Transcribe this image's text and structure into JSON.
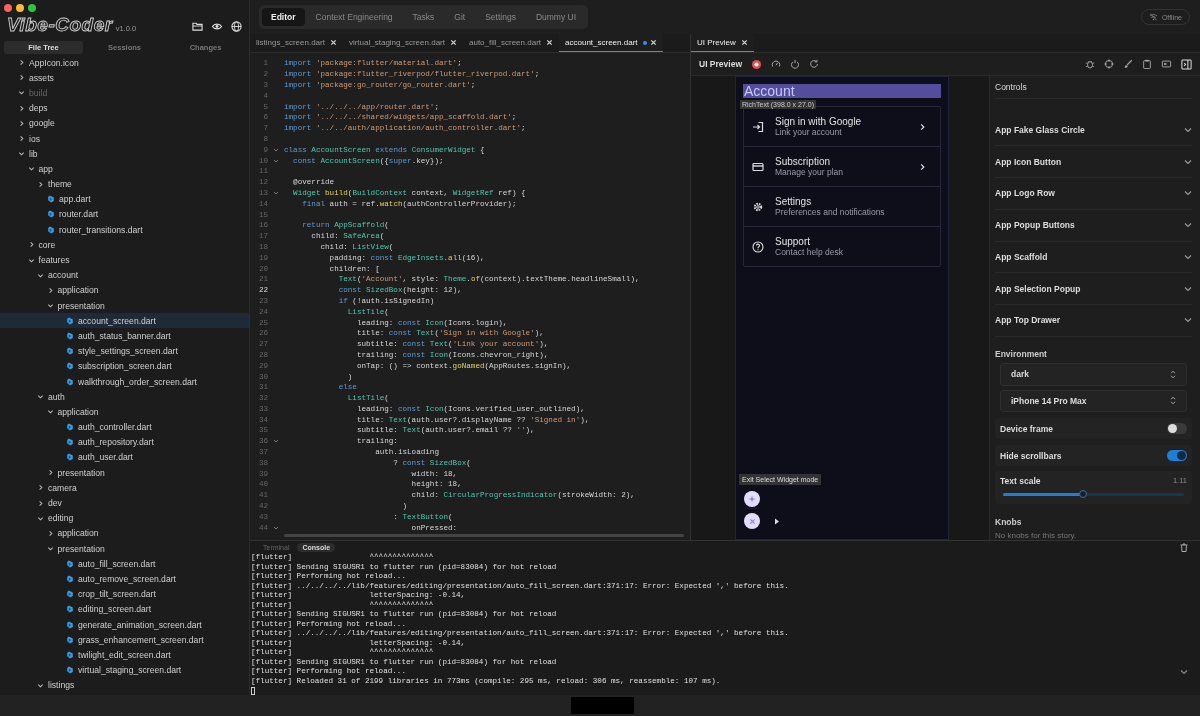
{
  "window": {
    "logo": "Vibe-Coder",
    "version": "v1.0.0"
  },
  "sidebar": {
    "tabs": [
      {
        "label": "File Tree",
        "selected": true
      },
      {
        "label": "Sessions",
        "selected": false
      },
      {
        "label": "Changes",
        "selected": false
      }
    ],
    "tree": [
      {
        "name": "AppIcon.icon",
        "kind": "folder",
        "expanded": false,
        "selected": false,
        "ignored": false
      },
      {
        "name": "assets",
        "kind": "folder",
        "expanded": false,
        "selected": false,
        "ignored": false
      },
      {
        "name": "build",
        "kind": "folder",
        "expanded": true,
        "selected": false,
        "ignored": true
      },
      {
        "name": "deps",
        "kind": "folder",
        "expanded": false,
        "selected": false,
        "ignored": false
      },
      {
        "name": "google",
        "kind": "folder",
        "expanded": false,
        "selected": false,
        "ignored": false
      },
      {
        "name": "ios",
        "kind": "folder",
        "expanded": false,
        "selected": false,
        "ignored": false
      },
      {
        "name": "lib",
        "kind": "folder",
        "expanded": true,
        "selected": false,
        "ignored": false,
        "children": [
          {
            "name": "app",
            "kind": "folder",
            "expanded": true,
            "selected": false,
            "ignored": false,
            "children": [
              {
                "name": "theme",
                "kind": "folder",
                "expanded": false,
                "selected": false,
                "ignored": false
              },
              {
                "name": "app.dart",
                "kind": "file",
                "selected": false,
                "ignored": false
              },
              {
                "name": "router.dart",
                "kind": "file",
                "selected": false,
                "ignored": false
              },
              {
                "name": "router_transitions.dart",
                "kind": "file",
                "selected": false,
                "ignored": false
              }
            ]
          },
          {
            "name": "core",
            "kind": "folder",
            "expanded": false,
            "selected": false,
            "ignored": false
          },
          {
            "name": "features",
            "kind": "folder",
            "expanded": true,
            "selected": false,
            "ignored": false,
            "children": [
              {
                "name": "account",
                "kind": "folder",
                "expanded": true,
                "selected": false,
                "ignored": false,
                "children": [
                  {
                    "name": "application",
                    "kind": "folder",
                    "expanded": false,
                    "selected": false,
                    "ignored": false
                  },
                  {
                    "name": "presentation",
                    "kind": "folder",
                    "expanded": true,
                    "selected": false,
                    "ignored": false,
                    "children": [
                      {
                        "name": "account_screen.dart",
                        "kind": "file",
                        "selected": true,
                        "ignored": false
                      },
                      {
                        "name": "auth_status_banner.dart",
                        "kind": "file",
                        "selected": false,
                        "ignored": false
                      },
                      {
                        "name": "style_settings_screen.dart",
                        "kind": "file",
                        "selected": false,
                        "ignored": false
                      },
                      {
                        "name": "subscription_screen.dart",
                        "kind": "file",
                        "selected": false,
                        "ignored": false
                      },
                      {
                        "name": "walkthrough_order_screen.dart",
                        "kind": "file",
                        "selected": false,
                        "ignored": false
                      }
                    ]
                  }
                ]
              },
              {
                "name": "auth",
                "kind": "folder",
                "expanded": true,
                "selected": false,
                "ignored": false,
                "children": [
                  {
                    "name": "application",
                    "kind": "folder",
                    "expanded": true,
                    "selected": false,
                    "ignored": false,
                    "children": [
                      {
                        "name": "auth_controller.dart",
                        "kind": "file",
                        "selected": false,
                        "ignored": false
                      },
                      {
                        "name": "auth_repository.dart",
                        "kind": "file",
                        "selected": false,
                        "ignored": false
                      },
                      {
                        "name": "auth_user.dart",
                        "kind": "file",
                        "selected": false,
                        "ignored": false
                      }
                    ]
                  },
                  {
                    "name": "presentation",
                    "kind": "folder",
                    "expanded": false,
                    "selected": false,
                    "ignored": false
                  }
                ]
              },
              {
                "name": "camera",
                "kind": "folder",
                "expanded": false,
                "selected": false,
                "ignored": false
              },
              {
                "name": "dev",
                "kind": "folder",
                "expanded": false,
                "selected": false,
                "ignored": false
              },
              {
                "name": "editing",
                "kind": "folder",
                "expanded": true,
                "selected": false,
                "ignored": false,
                "children": [
                  {
                    "name": "application",
                    "kind": "folder",
                    "expanded": false,
                    "selected": false,
                    "ignored": false
                  },
                  {
                    "name": "presentation",
                    "kind": "folder",
                    "expanded": true,
                    "selected": false,
                    "ignored": false,
                    "children": [
                      {
                        "name": "auto_fill_screen.dart",
                        "kind": "file",
                        "selected": false,
                        "ignored": false
                      },
                      {
                        "name": "auto_remove_screen.dart",
                        "kind": "file",
                        "selected": false,
                        "ignored": false
                      },
                      {
                        "name": "crop_tilt_screen.dart",
                        "kind": "file",
                        "selected": false,
                        "ignored": false
                      },
                      {
                        "name": "editing_screen.dart",
                        "kind": "file",
                        "selected": false,
                        "ignored": false
                      },
                      {
                        "name": "generate_animation_screen.dart",
                        "kind": "file",
                        "selected": false,
                        "ignored": false
                      },
                      {
                        "name": "grass_enhancement_screen.dart",
                        "kind": "file",
                        "selected": false,
                        "ignored": false
                      },
                      {
                        "name": "twilight_edit_screen.dart",
                        "kind": "file",
                        "selected": false,
                        "ignored": false
                      },
                      {
                        "name": "virtual_staging_screen.dart",
                        "kind": "file",
                        "selected": false,
                        "ignored": false
                      }
                    ]
                  }
                ]
              },
              {
                "name": "listings",
                "kind": "folder",
                "expanded": true,
                "selected": false,
                "ignored": false
              }
            ]
          }
        ]
      }
    ]
  },
  "nav_tabs": [
    {
      "label": "Editor",
      "selected": true
    },
    {
      "label": "Context Engineering",
      "selected": false
    },
    {
      "label": "Tasks",
      "selected": false
    },
    {
      "label": "Git",
      "selected": false
    },
    {
      "label": "Settings",
      "selected": false
    },
    {
      "label": "Dummy UI",
      "selected": false
    }
  ],
  "status": {
    "label": "Offline"
  },
  "editor": {
    "tabs": [
      {
        "label": "listings_screen.dart",
        "selected": false,
        "modified": false
      },
      {
        "label": "virtual_staging_screen.dart",
        "selected": false,
        "modified": false
      },
      {
        "label": "auto_fill_screen.dart",
        "selected": false,
        "modified": false
      },
      {
        "label": "account_screen.dart",
        "selected": true,
        "modified": true
      }
    ],
    "lines": [
      {
        "number": "1",
        "foldable": false,
        "current": false,
        "tokens": [
          {
            "kind": "kw",
            "text": "import "
          },
          {
            "kind": "str",
            "text": "'package:flutter/material.dart'"
          },
          {
            "kind": "p",
            "text": ";"
          }
        ]
      },
      {
        "number": "2",
        "foldable": false,
        "current": false,
        "tokens": [
          {
            "kind": "kw",
            "text": "import "
          },
          {
            "kind": "str",
            "text": "'package:flutter_riverpod/flutter_riverpod.dart'"
          },
          {
            "kind": "p",
            "text": ";"
          }
        ]
      },
      {
        "number": "3",
        "foldable": false,
        "current": false,
        "tokens": [
          {
            "kind": "kw",
            "text": "import "
          },
          {
            "kind": "str",
            "text": "'package:go_router/go_router.dart'"
          },
          {
            "kind": "p",
            "text": ";"
          }
        ]
      },
      {
        "number": "4",
        "foldable": false,
        "current": false
      },
      {
        "number": "5",
        "foldable": false,
        "current": false,
        "tokens": [
          {
            "kind": "kw",
            "text": "import "
          },
          {
            "kind": "str",
            "text": "'../../../app/router.dart'"
          },
          {
            "kind": "p",
            "text": ";"
          }
        ]
      },
      {
        "number": "6",
        "foldable": false,
        "current": false,
        "tokens": [
          {
            "kind": "kw",
            "text": "import "
          },
          {
            "kind": "str",
            "text": "'../../../shared/widgets/app_scaffold.dart'"
          },
          {
            "kind": "p",
            "text": ";"
          }
        ]
      },
      {
        "number": "7",
        "foldable": false,
        "current": false,
        "tokens": [
          {
            "kind": "kw",
            "text": "import "
          },
          {
            "kind": "str",
            "text": "'../../auth/application/auth_controller.dart'"
          },
          {
            "kind": "p",
            "text": ";"
          }
        ]
      },
      {
        "number": "8",
        "foldable": false,
        "current": false
      },
      {
        "number": "9",
        "foldable": true,
        "current": false,
        "tokens": [
          {
            "kind": "kw",
            "text": "class "
          },
          {
            "kind": "type",
            "text": "AccountScreen "
          },
          {
            "kind": "kw",
            "text": "extends "
          },
          {
            "kind": "type",
            "text": "ConsumerWidget"
          },
          {
            "kind": "p",
            "text": " {"
          }
        ]
      },
      {
        "number": "10",
        "foldable": true,
        "current": false,
        "tokens": [
          {
            "kind": "kw",
            "text": "  const "
          },
          {
            "kind": "type",
            "text": "AccountScreen"
          },
          {
            "kind": "p",
            "text": "({"
          },
          {
            "kind": "kw",
            "text": "super"
          },
          {
            "kind": "p",
            "text": ".key});"
          }
        ]
      },
      {
        "number": "11",
        "foldable": false,
        "current": false
      },
      {
        "number": "12",
        "foldable": false,
        "current": false,
        "tokens": [
          {
            "kind": "p",
            "text": "  @override"
          }
        ]
      },
      {
        "number": "13",
        "foldable": true,
        "current": false,
        "tokens": [
          {
            "kind": "type",
            "text": "  Widget "
          },
          {
            "kind": "fn",
            "text": "build"
          },
          {
            "kind": "p",
            "text": "("
          },
          {
            "kind": "type",
            "text": "BuildContext"
          },
          {
            "kind": "p",
            "text": " context, "
          },
          {
            "kind": "type",
            "text": "WidgetRef"
          },
          {
            "kind": "p",
            "text": " ref) {"
          }
        ]
      },
      {
        "number": "14",
        "foldable": false,
        "current": false,
        "tokens": [
          {
            "kind": "kw",
            "text": "    final "
          },
          {
            "kind": "p",
            "text": "auth = ref."
          },
          {
            "kind": "fn",
            "text": "watch"
          },
          {
            "kind": "p",
            "text": "(authControllerProvider);"
          }
        ]
      },
      {
        "number": "15",
        "foldable": false,
        "current": false
      },
      {
        "number": "16",
        "foldable": false,
        "current": false,
        "tokens": [
          {
            "kind": "kw",
            "text": "    return "
          },
          {
            "kind": "type",
            "text": "AppScaffold"
          },
          {
            "kind": "p",
            "text": "("
          }
        ]
      },
      {
        "number": "17",
        "foldable": false,
        "current": false,
        "tokens": [
          {
            "kind": "p",
            "text": "      child: "
          },
          {
            "kind": "type",
            "text": "SafeArea"
          },
          {
            "kind": "p",
            "text": "("
          }
        ]
      },
      {
        "number": "18",
        "foldable": false,
        "current": false,
        "tokens": [
          {
            "kind": "p",
            "text": "        child: "
          },
          {
            "kind": "type",
            "text": "ListView"
          },
          {
            "kind": "p",
            "text": "("
          }
        ]
      },
      {
        "number": "19",
        "foldable": false,
        "current": false,
        "tokens": [
          {
            "kind": "p",
            "text": "          padding: "
          },
          {
            "kind": "kw",
            "text": "const "
          },
          {
            "kind": "type",
            "text": "EdgeInsets"
          },
          {
            "kind": "p",
            "text": "."
          },
          {
            "kind": "fn",
            "text": "all"
          },
          {
            "kind": "p",
            "text": "(16),"
          }
        ]
      },
      {
        "number": "20",
        "foldable": false,
        "current": false,
        "tokens": [
          {
            "kind": "p",
            "text": "          children: ["
          }
        ]
      },
      {
        "number": "21",
        "foldable": false,
        "current": false,
        "tokens": [
          {
            "kind": "type",
            "text": "            Text"
          },
          {
            "kind": "p",
            "text": "("
          },
          {
            "kind": "str",
            "text": "'Account'"
          },
          {
            "kind": "p",
            "text": ", style: "
          },
          {
            "kind": "type",
            "text": "Theme"
          },
          {
            "kind": "p",
            "text": "."
          },
          {
            "kind": "fn",
            "text": "of"
          },
          {
            "kind": "p",
            "text": "(context).textTheme.headlineSmall),"
          }
        ]
      },
      {
        "number": "22",
        "foldable": false,
        "current": true,
        "tokens": [
          {
            "kind": "kw",
            "text": "            const "
          },
          {
            "kind": "type",
            "text": "SizedBox"
          },
          {
            "kind": "p",
            "text": "(height: 12),"
          }
        ]
      },
      {
        "number": "23",
        "foldable": false,
        "current": false,
        "tokens": [
          {
            "kind": "kw",
            "text": "            if "
          },
          {
            "kind": "p",
            "text": "(!auth.isSignedIn)"
          }
        ]
      },
      {
        "number": "24",
        "foldable": false,
        "current": false,
        "tokens": [
          {
            "kind": "type",
            "text": "              ListTile"
          },
          {
            "kind": "p",
            "text": "("
          }
        ]
      },
      {
        "number": "25",
        "foldable": false,
        "current": false,
        "tokens": [
          {
            "kind": "p",
            "text": "                leading: "
          },
          {
            "kind": "kw",
            "text": "const "
          },
          {
            "kind": "type",
            "text": "Icon"
          },
          {
            "kind": "p",
            "text": "(Icons.login),"
          }
        ]
      },
      {
        "number": "26",
        "foldable": false,
        "current": false,
        "tokens": [
          {
            "kind": "p",
            "text": "                title: "
          },
          {
            "kind": "kw",
            "text": "const "
          },
          {
            "kind": "type",
            "text": "Text"
          },
          {
            "kind": "p",
            "text": "("
          },
          {
            "kind": "str",
            "text": "'Sign in with Google'"
          },
          {
            "kind": "p",
            "text": "),"
          }
        ]
      },
      {
        "number": "27",
        "foldable": false,
        "current": false,
        "tokens": [
          {
            "kind": "p",
            "text": "                subtitle: "
          },
          {
            "kind": "kw",
            "text": "const "
          },
          {
            "kind": "type",
            "text": "Text"
          },
          {
            "kind": "p",
            "text": "("
          },
          {
            "kind": "str",
            "text": "'Link your account'"
          },
          {
            "kind": "p",
            "text": "),"
          }
        ]
      },
      {
        "number": "28",
        "foldable": false,
        "current": false,
        "tokens": [
          {
            "kind": "p",
            "text": "                trailing: "
          },
          {
            "kind": "kw",
            "text": "const "
          },
          {
            "kind": "type",
            "text": "Icon"
          },
          {
            "kind": "p",
            "text": "(Icons.chevron_right),"
          }
        ]
      },
      {
        "number": "29",
        "foldable": false,
        "current": false,
        "tokens": [
          {
            "kind": "p",
            "text": "                onTap: () => context."
          },
          {
            "kind": "fn",
            "text": "goNamed"
          },
          {
            "kind": "p",
            "text": "(AppRoutes.signIn),"
          }
        ]
      },
      {
        "number": "30",
        "foldable": false,
        "current": false,
        "tokens": [
          {
            "kind": "p",
            "text": "              )"
          }
        ]
      },
      {
        "number": "31",
        "foldable": false,
        "current": false,
        "tokens": [
          {
            "kind": "kw",
            "text": "            else"
          }
        ]
      },
      {
        "number": "32",
        "foldable": false,
        "current": false,
        "tokens": [
          {
            "kind": "type",
            "text": "              ListTile"
          },
          {
            "kind": "p",
            "text": "("
          }
        ]
      },
      {
        "number": "33",
        "foldable": false,
        "current": false,
        "tokens": [
          {
            "kind": "p",
            "text": "                leading: "
          },
          {
            "kind": "kw",
            "text": "const "
          },
          {
            "kind": "type",
            "text": "Icon"
          },
          {
            "kind": "p",
            "text": "(Icons.verified_user_outlined),"
          }
        ]
      },
      {
        "number": "34",
        "foldable": false,
        "current": false,
        "tokens": [
          {
            "kind": "p",
            "text": "                title: "
          },
          {
            "kind": "type",
            "text": "Text"
          },
          {
            "kind": "p",
            "text": "(auth.user?.displayName ?? "
          },
          {
            "kind": "str",
            "text": "'Signed in'"
          },
          {
            "kind": "p",
            "text": "),"
          }
        ]
      },
      {
        "number": "35",
        "foldable": false,
        "current": false,
        "tokens": [
          {
            "kind": "p",
            "text": "                subtitle: "
          },
          {
            "kind": "type",
            "text": "Text"
          },
          {
            "kind": "p",
            "text": "(auth.user?.email ?? "
          },
          {
            "kind": "str",
            "text": "''"
          },
          {
            "kind": "p",
            "text": "),"
          }
        ]
      },
      {
        "number": "36",
        "foldable": true,
        "current": false,
        "tokens": [
          {
            "kind": "p",
            "text": "                trailing:"
          }
        ]
      },
      {
        "number": "37",
        "foldable": false,
        "current": false,
        "tokens": [
          {
            "kind": "p",
            "text": "                    auth.isLoading"
          }
        ]
      },
      {
        "number": "38",
        "foldable": false,
        "current": false,
        "tokens": [
          {
            "kind": "p",
            "text": "                        ? "
          },
          {
            "kind": "kw",
            "text": "const "
          },
          {
            "kind": "type",
            "text": "SizedBox"
          },
          {
            "kind": "p",
            "text": "("
          }
        ]
      },
      {
        "number": "39",
        "foldable": false,
        "current": false,
        "tokens": [
          {
            "kind": "p",
            "text": "                            width: 18,"
          }
        ]
      },
      {
        "number": "40",
        "foldable": false,
        "current": false,
        "tokens": [
          {
            "kind": "p",
            "text": "                            height: 18,"
          }
        ]
      },
      {
        "number": "41",
        "foldable": false,
        "current": false,
        "tokens": [
          {
            "kind": "p",
            "text": "                            child: "
          },
          {
            "kind": "type",
            "text": "CircularProgressIndicator"
          },
          {
            "kind": "p",
            "text": "(strokeWidth: 2),"
          }
        ]
      },
      {
        "number": "42",
        "foldable": false,
        "current": false,
        "tokens": [
          {
            "kind": "p",
            "text": "                          )"
          }
        ]
      },
      {
        "number": "43",
        "foldable": false,
        "current": false,
        "tokens": [
          {
            "kind": "p",
            "text": "                        : "
          },
          {
            "kind": "type",
            "text": "TextButton"
          },
          {
            "kind": "p",
            "text": "("
          }
        ]
      },
      {
        "number": "44",
        "foldable": true,
        "current": false,
        "tokens": [
          {
            "kind": "p",
            "text": "                            onPressed:"
          }
        ]
      }
    ]
  },
  "preview": {
    "tab": {
      "label": "UI Preview",
      "selected": true
    },
    "title": "UI Preview",
    "recording": true,
    "screen": {
      "heading": "Account",
      "heading_highlighted": true,
      "inspector_tooltip": "RichText (398.0 x 27.0)",
      "tiles": [
        {
          "title": "Sign in with Google",
          "subtitle": "Link your account",
          "chevron": true
        },
        {
          "title": "Subscription",
          "subtitle": "Manage your plan",
          "chevron": true
        },
        {
          "title": "Settings",
          "subtitle": "Preferences and notifications",
          "chevron": false
        },
        {
          "title": "Support",
          "subtitle": "Contact help desk",
          "chevron": false
        }
      ],
      "mode_tooltip": "Exit Select Widget mode"
    }
  },
  "controls": {
    "title": "Controls",
    "components": [
      {
        "name": "App Fake Glass Circle",
        "expanded": false
      },
      {
        "name": "App Icon Button",
        "expanded": false
      },
      {
        "name": "App Logo Row",
        "expanded": false
      },
      {
        "name": "App Popup Buttons",
        "expanded": false
      },
      {
        "name": "App Scaffold",
        "expanded": false
      },
      {
        "name": "App Selection Popup",
        "expanded": false
      },
      {
        "name": "App Top Drawer",
        "expanded": false
      }
    ],
    "environment": {
      "title": "Environment",
      "theme": "dark",
      "device": "iPhone 14 Pro Max",
      "toggles": [
        {
          "label": "Device frame",
          "on": false
        },
        {
          "label": "Hide scrollbars",
          "on": true
        }
      ],
      "text_scale": {
        "label": "Text scale",
        "reading": "1.11",
        "level": 0.44
      }
    },
    "knobs": {
      "title": "Knobs",
      "message": "No knobs for this story."
    }
  },
  "console": {
    "tabs": [
      {
        "label": "Terminal",
        "selected": false
      },
      {
        "label": "Console",
        "selected": true
      }
    ],
    "lines": [
      "[flutter]                 ^^^^^^^^^^^^^^",
      "[flutter] Sending SIGUSR1 to flutter run (pid=83084) for hot reload",
      "[flutter] Performing hot reload...",
      "[flutter] ../../../../lib/features/editing/presentation/auto_fill_screen.dart:371:17: Error: Expected ',' before this.",
      "[flutter]                 letterSpacing: -0.14,",
      "[flutter]                 ^^^^^^^^^^^^^^",
      "[flutter] Sending SIGUSR1 to flutter run (pid=83084) for hot reload",
      "[flutter] Performing hot reload...",
      "[flutter] ../../../../lib/features/editing/presentation/auto_fill_screen.dart:371:17: Error: Expected ',' before this.",
      "[flutter]                 letterSpacing: -0.14,",
      "[flutter]                 ^^^^^^^^^^^^^^",
      "[flutter] Sending SIGUSR1 to flutter run (pid=83084) for hot reload",
      "[flutter] Performing hot reload...",
      "[flutter] Reloaded 31 of 2199 libraries in 773ms (compile: 295 ms, reload: 306 ms, reassemble: 107 ms)."
    ]
  }
}
